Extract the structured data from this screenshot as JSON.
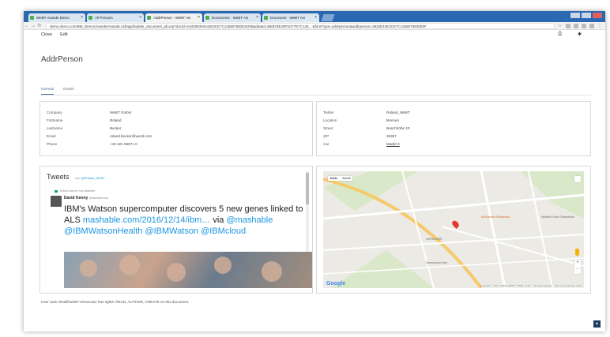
{
  "browser": {
    "tabs": [
      {
        "label": "WeBT Avande Demo",
        "active": false
      },
      {
        "label": "All Persons",
        "active": false
      },
      {
        "label": "AddrPerson - WeBT Avi",
        "active": true
      },
      {
        "label": "Documents - WeBT Avi",
        "active": false
      },
      {
        "label": "Document - WeBT Avi",
        "active": false
      }
    ],
    "url": "demo.demo.com/BM_Demo/Avande/Avande.nsf/app/builder_document_all.xsp?docId=%203829AE44E3CE7C125807683D1D06&dataId=BEB76E28F0CF7E7C125... &formType=addrperson&addrperson=3824E44E3CE7C1258076830E0F"
  },
  "toolbar": {
    "close_label": "Close",
    "edit_label": "Edit"
  },
  "page": {
    "title": "AddrPerson",
    "tabs": [
      {
        "label": "General",
        "active": true
      },
      {
        "label": "Details",
        "active": false
      }
    ]
  },
  "left_fields": [
    {
      "label": "Company",
      "value": "WeBT GmbH"
    },
    {
      "label": "Firstname",
      "value": "Roland"
    },
    {
      "label": "Lastname",
      "value": "Becker"
    },
    {
      "label": "Email",
      "value": "roland.becker@we4it.com"
    },
    {
      "label": "Phone",
      "value": "+49 421 96971 0"
    }
  ],
  "right_fields": [
    {
      "label": "Twitter",
      "value": "Roland_WeBT"
    },
    {
      "label": "Location",
      "value": "Bremen"
    },
    {
      "label": "Street",
      "value": "Buschhöhe 10"
    },
    {
      "label": "ZIP",
      "value": "28357"
    },
    {
      "label": "Car",
      "value": "Model X"
    }
  ],
  "tweets": {
    "heading": "Tweets",
    "by_prefix": "von",
    "handle": "@Roland_WeBT",
    "retweet_label": "Roland Becker hat retweetet",
    "author": "David Kenny",
    "author_handle": "@davidkenny",
    "text_main": "IBM's Watson supercomputer discovers 5 new genes linked to ALS ",
    "text_link": "mashable.com/2016/12/14/ibm…",
    "text_via": " via ",
    "text_mentions": "@mashable @IBMWatsonHealth @IBMWatson @IBMcloud"
  },
  "map": {
    "type_options": [
      "Karte",
      "Satellit"
    ],
    "labels": [
      "McDonald's Restaurant",
      "Wilhelm Focke Oberschule",
      "HORN-LEHE",
      "Gymnasium Horn"
    ],
    "google": "Google",
    "attribution": "Kartendaten © 2016 GeoBasis-DE/BKG (©2009), Google · Nutzungsbedingungen · Fehler bei Google Maps melden"
  },
  "footer": {
    "rights_text": "User Jack ONeill/WeBT-Showcase has rights: READ, AUTHOR, CREATE on this document."
  },
  "colors": {
    "tabbar": "#2a69b2",
    "active_tab_underline": "#4a6fa5",
    "link_blue": "#1b95e0",
    "map_pin": "#e53935"
  }
}
